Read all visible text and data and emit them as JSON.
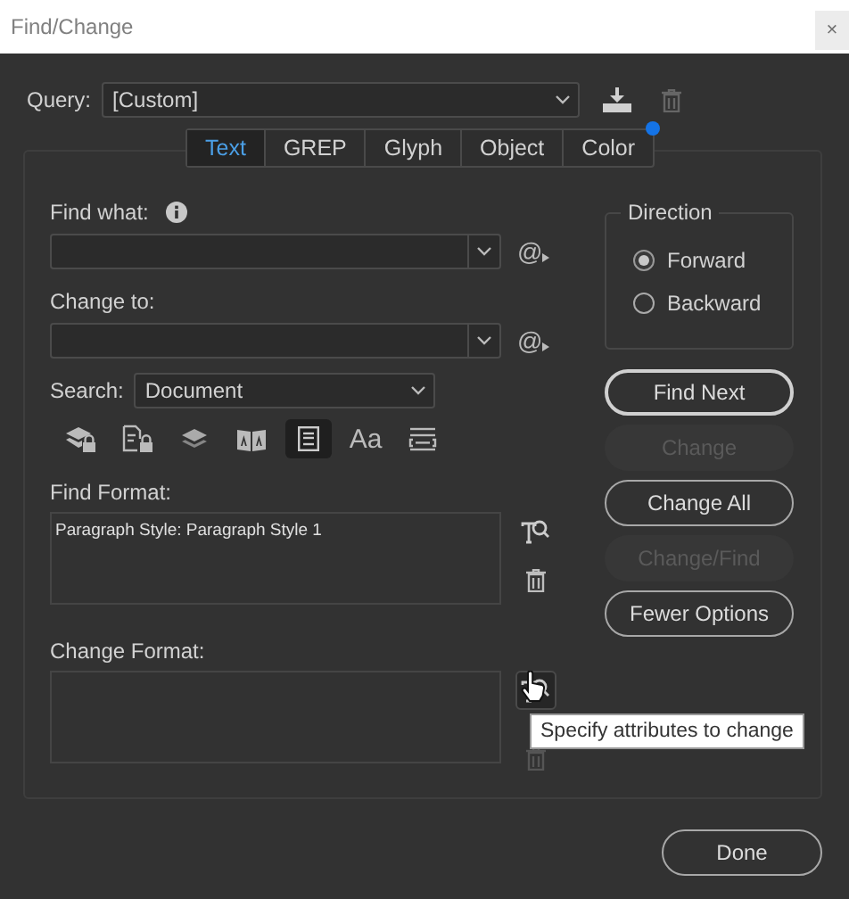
{
  "window": {
    "title": "Find/Change",
    "close_button": "×"
  },
  "query": {
    "label": "Query:",
    "value": "[Custom]"
  },
  "tabs": [
    {
      "label": "Text",
      "selected": true,
      "modified": false
    },
    {
      "label": "GREP",
      "selected": false,
      "modified": false
    },
    {
      "label": "Glyph",
      "selected": false,
      "modified": false
    },
    {
      "label": "Object",
      "selected": false,
      "modified": false
    },
    {
      "label": "Color",
      "selected": false,
      "modified": true
    }
  ],
  "find_what": {
    "label": "Find what:",
    "special_menu": "@"
  },
  "change_to": {
    "label": "Change to:",
    "special_menu": "@"
  },
  "search": {
    "label": "Search:",
    "value": "Document"
  },
  "search_options": [
    {
      "kind": "locked-layers",
      "on": false
    },
    {
      "kind": "locked-stories",
      "on": false
    },
    {
      "kind": "hidden-layers",
      "on": false
    },
    {
      "kind": "master-pages",
      "on": false
    },
    {
      "kind": "footnotes",
      "on": true
    },
    {
      "kind": "case-sensitive",
      "label": "Aa",
      "on": false
    },
    {
      "kind": "whole-word",
      "on": false
    }
  ],
  "find_format": {
    "label": "Find Format:",
    "value": "Paragraph Style: Paragraph Style 1",
    "specify_hovered": false
  },
  "change_format": {
    "label": "Change Format:",
    "specify_hovered": true
  },
  "tooltip": {
    "text": "Specify attributes to change"
  },
  "direction": {
    "label": "Direction",
    "options": [
      {
        "label": "Forward",
        "selected": true
      },
      {
        "label": "Backward",
        "selected": false
      }
    ]
  },
  "buttons": [
    {
      "label": "Find Next",
      "disabled": false,
      "default": true
    },
    {
      "label": "Change",
      "disabled": true,
      "default": false
    },
    {
      "label": "Change All",
      "disabled": false,
      "default": false
    },
    {
      "label": "Change/Find",
      "disabled": true,
      "default": false
    },
    {
      "label": "Fewer Options",
      "disabled": false,
      "default": false
    }
  ],
  "done_button": {
    "label": "Done"
  }
}
